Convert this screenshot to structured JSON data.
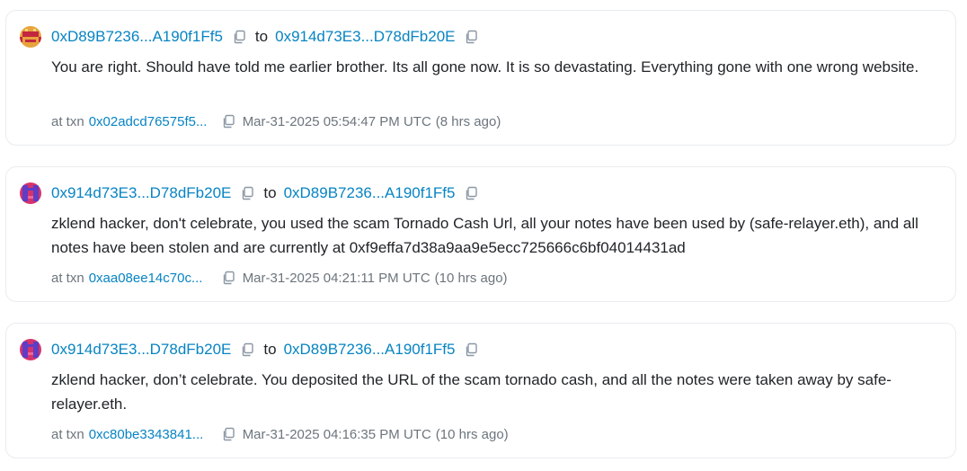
{
  "comments": [
    {
      "avatar_icon": "avatar-blockie-icon",
      "avatar_colors": [
        "#e8a33c",
        "#c2273f"
      ],
      "from": "0xD89B7236...A190f1Ff5",
      "to_word": "to",
      "to": "0x914d73E3...D78dFb20E",
      "message": "You are right. Should have told me earlier brother. Its all gone now. It is so devastating. Everything gone with one wrong website.",
      "txn_prefix": "at txn",
      "txn": "0x02adcd76575f5...",
      "timestamp": "Mar-31-2025 05:54:47 PM UTC",
      "age": "(8 hrs ago)"
    },
    {
      "avatar_icon": "avatar-blockie-icon",
      "avatar_colors": [
        "#d6336c",
        "#5f3dc4"
      ],
      "from": "0x914d73E3...D78dFb20E",
      "to_word": "to",
      "to": "0xD89B7236...A190f1Ff5",
      "message": "zklend hacker, don't celebrate, you used the scam Tornado Cash Url, all your notes have been used by (safe-relayer.eth), and all notes have been stolen and are currently at 0xf9effa7d38a9aa9e5ecc725666c6bf04014431ad",
      "txn_prefix": "at txn",
      "txn": "0xaa08ee14c70c...",
      "timestamp": "Mar-31-2025 04:21:11 PM UTC",
      "age": "(10 hrs ago)"
    },
    {
      "avatar_icon": "avatar-blockie-icon",
      "avatar_colors": [
        "#d6336c",
        "#5f3dc4"
      ],
      "from": "0x914d73E3...D78dFb20E",
      "to_word": "to",
      "to": "0xD89B7236...A190f1Ff5",
      "message": "zklend hacker, don’t celebrate. You deposited the URL of the scam tornado cash, and all the notes were taken away by safe-relayer.eth.",
      "txn_prefix": "at txn",
      "txn": "0xc80be3343841...",
      "timestamp": "Mar-31-2025 04:16:35 PM UTC",
      "age": "(10 hrs ago)"
    }
  ],
  "colors": {
    "link": "#0784c3",
    "muted": "#6c757d",
    "text": "#212529",
    "border": "#e9ecef"
  }
}
